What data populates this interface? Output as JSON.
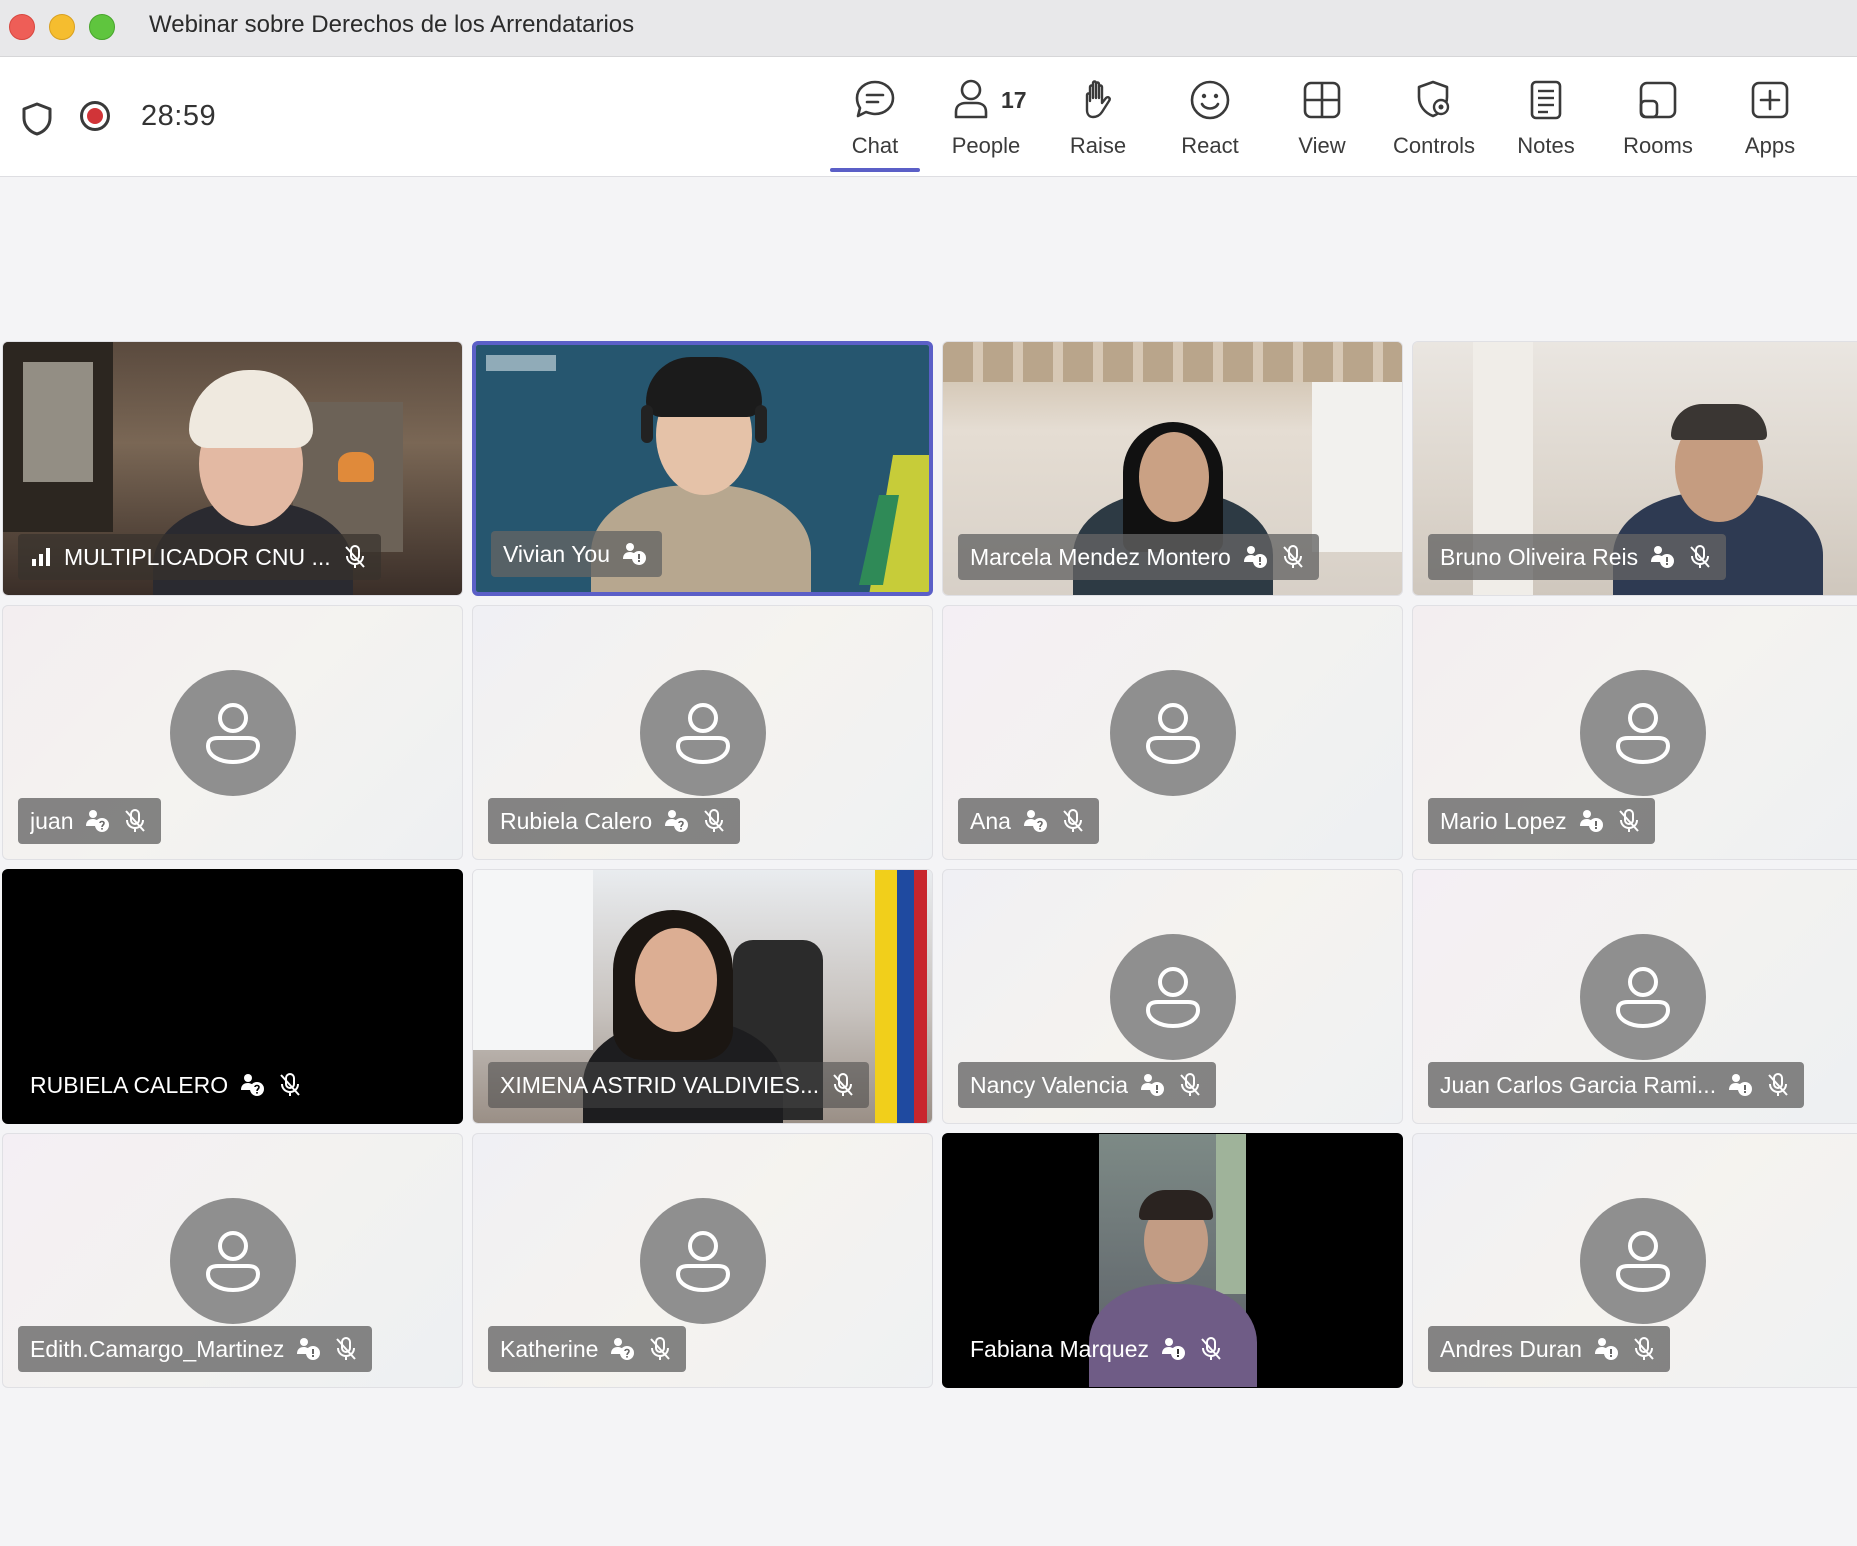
{
  "window": {
    "title": "Webinar sobre Derechos de los Arrendatarios"
  },
  "toolbar": {
    "timer": "28:59",
    "people_count": "17",
    "items": [
      {
        "label": "Chat",
        "icon": "chat-icon"
      },
      {
        "label": "People",
        "icon": "people-icon"
      },
      {
        "label": "Raise",
        "icon": "raise-hand-icon"
      },
      {
        "label": "React",
        "icon": "react-icon"
      },
      {
        "label": "View",
        "icon": "view-icon"
      },
      {
        "label": "Controls",
        "icon": "controls-icon"
      },
      {
        "label": "Notes",
        "icon": "notes-icon"
      },
      {
        "label": "Rooms",
        "icon": "rooms-icon"
      },
      {
        "label": "Apps",
        "icon": "apps-icon"
      }
    ],
    "active_item": "Chat"
  },
  "participants": [
    {
      "name": "MULTIPLICADOR CNU ...",
      "video": true,
      "muted": true
    },
    {
      "name": "Vivian You",
      "video": true,
      "muted": false
    },
    {
      "name": "Marcela Mendez Montero",
      "video": true,
      "muted": true
    },
    {
      "name": "Bruno Oliveira Reis",
      "video": true,
      "muted": true
    },
    {
      "name": "juan",
      "video": false,
      "muted": true
    },
    {
      "name": "Rubiela Calero",
      "video": false,
      "muted": true
    },
    {
      "name": "Ana",
      "video": false,
      "muted": true
    },
    {
      "name": "Mario Lopez",
      "video": false,
      "muted": true
    },
    {
      "name": "RUBIELA CALERO",
      "video": false,
      "muted": true
    },
    {
      "name": "XIMENA ASTRID VALDIVIES...",
      "video": true,
      "muted": true
    },
    {
      "name": "Nancy Valencia",
      "video": false,
      "muted": true
    },
    {
      "name": "Juan Carlos Garcia Rami...",
      "video": false,
      "muted": true
    },
    {
      "name": "Edith.Camargo_Martinez",
      "video": false,
      "muted": true
    },
    {
      "name": "Katherine",
      "video": false,
      "muted": true
    },
    {
      "name": "Fabiana Marquez",
      "video": true,
      "muted": true
    },
    {
      "name": "Andres Duran",
      "video": false,
      "muted": true
    }
  ],
  "colors": {
    "accent": "#5b5fc7",
    "recording": "#d13438"
  }
}
